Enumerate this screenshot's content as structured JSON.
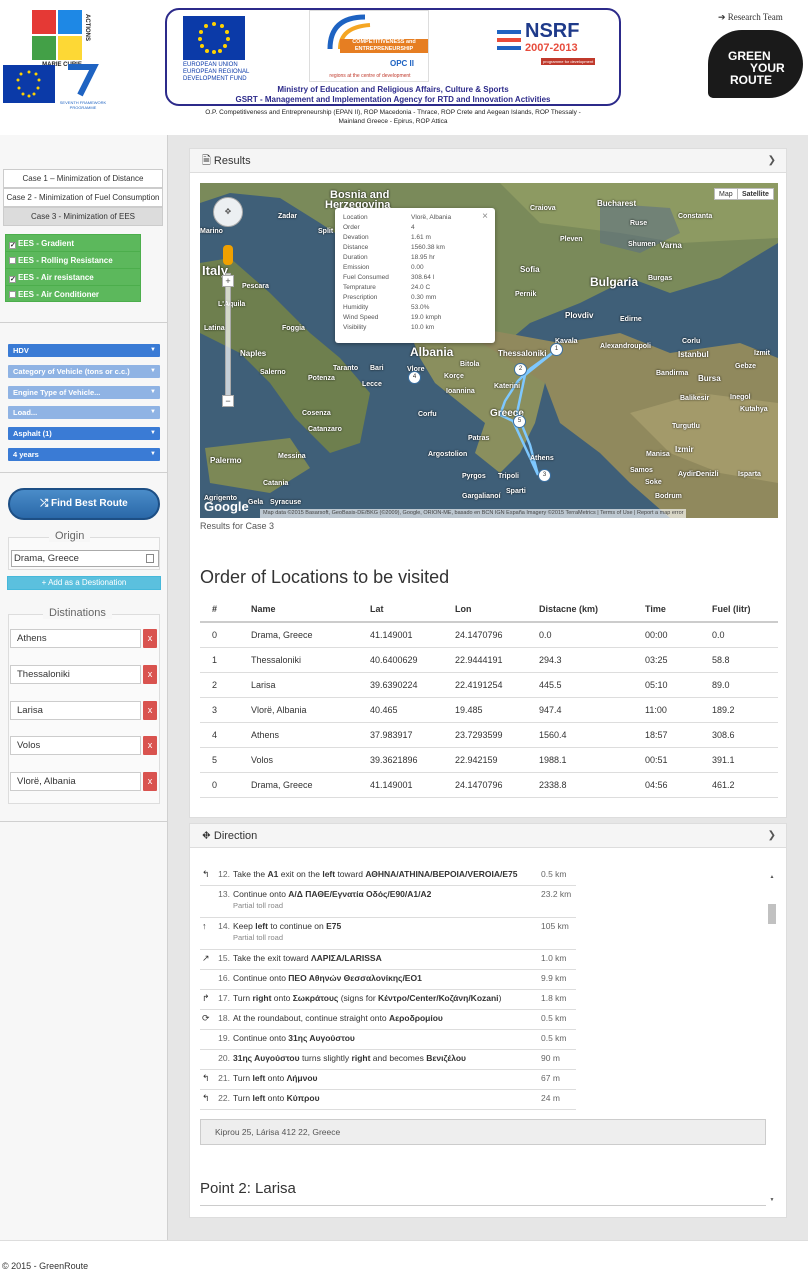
{
  "header": {
    "mc_label": "MARIE CURIE",
    "mc_actions": "ACTIONS",
    "fp7_label": "SEVENTH FRAMEWORK PROGRAMME",
    "eu_text": [
      "EUROPEAN UNION",
      "EUROPEAN REGIONAL",
      "DEVELOPMENT FUND"
    ],
    "opc_title": "COMPETITIVENESS and ENTREPRENEURSHIP",
    "opc_sub": "OPC II",
    "opc_tagline": "regions at the centre of development",
    "nsrf_title": "NSRF",
    "nsrf_years": "2007-2013",
    "nsrf_sub": "programme for development",
    "ministry_line1": "Ministry of Education and Religious Affairs, Culture & Sports",
    "ministry_line2": "GSRT -  Management and Implementation Agency for RTD and Innovation Activities",
    "sub_line1": "O.P. Competitiveness and Entrepreneurship (EPAN II), ROP Macedonia - Thrace, ROP Crete and Aegean Islands, ROP Thessaly -",
    "sub_line2": "Mainland Greece - Epirus, ROP Attica",
    "research_team": "Research Team",
    "logo_words": [
      "GREEN",
      "YOUR",
      "ROUTE"
    ]
  },
  "sidebar": {
    "cases": [
      {
        "label": "Case 1 – Minimization of Distance",
        "active": false
      },
      {
        "label": "Case 2 - Minimization of Fuel Consumption",
        "active": false
      },
      {
        "label": "Case 3 - Minimization of EES",
        "active": true
      }
    ],
    "ees": [
      {
        "label": "EES - Gradient",
        "checked": true
      },
      {
        "label": "EES - Rolling Resistance",
        "checked": false
      },
      {
        "label": "EES - Air resistance",
        "checked": true
      },
      {
        "label": "EES - Air Conditioner",
        "checked": false
      }
    ],
    "selects": [
      {
        "label": "HDV",
        "style": "dark"
      },
      {
        "label": "Category of Vehicle (tons or c.c.)",
        "style": "light"
      },
      {
        "label": "Engine Type of Vehicle...",
        "style": "light"
      },
      {
        "label": "Load...",
        "style": "light"
      },
      {
        "label": "Asphalt (1)",
        "style": "dark"
      },
      {
        "label": "4 years",
        "style": "dark"
      }
    ],
    "find_button": "Find Best Route",
    "origin_legend": "Origin",
    "origin_value": "Drama, Greece",
    "add_destination": "+ Add as a Destionation",
    "destinations_legend": "Distinations",
    "destinations": [
      "Athens",
      "Thessaloniki",
      "Larisa",
      "Volos",
      "Vlorë, Albania"
    ],
    "remove_label": "x"
  },
  "results": {
    "title": "Results",
    "results_for": "Results for Case 3",
    "map_buttons": [
      "Map",
      "Satellite"
    ],
    "map_credit": "Map data ©2015 Basarsoft, GeoBasis-DE/BKG (©2009), Google, ORION-ME, basado en BCN IGN España Imagery ©2015 TerraMetrics | Terms of Use | Report a map error",
    "google": "Google",
    "map_labels": [
      {
        "text": "Bosnia and",
        "size": 11
      },
      {
        "text": "Herzegovina",
        "size": 11
      },
      {
        "text": "Bulgaria",
        "size": 12
      },
      {
        "text": "Albania",
        "size": 12
      },
      {
        "text": "Greece",
        "size": 10
      },
      {
        "text": "Italy",
        "size": 13
      },
      {
        "text": "Bucharest",
        "size": 8
      },
      {
        "text": "Sofia",
        "size": 8
      },
      {
        "text": "Thessaloniki",
        "size": 8
      },
      {
        "text": "Naples",
        "size": 8
      },
      {
        "text": "Palermo",
        "size": 8
      },
      {
        "text": "Istanbul",
        "size": 8
      },
      {
        "text": "Izmir",
        "size": 8
      },
      {
        "text": "Bursa",
        "size": 8
      },
      {
        "text": "Plovdiv",
        "size": 8
      },
      {
        "text": "Varna",
        "size": 8
      },
      {
        "text": "Split",
        "size": 7
      },
      {
        "text": "Zadar",
        "size": 7
      },
      {
        "text": "Craiova",
        "size": 7
      },
      {
        "text": "Constanta",
        "size": 7
      },
      {
        "text": "Burgas",
        "size": 7
      },
      {
        "text": "Edirne",
        "size": 7
      },
      {
        "text": "Corfu",
        "size": 7
      },
      {
        "text": "Patras",
        "size": 7
      },
      {
        "text": "Athens",
        "size": 7
      },
      {
        "text": "Messina",
        "size": 7
      },
      {
        "text": "Catania",
        "size": 7
      },
      {
        "text": "Lecce",
        "size": 7
      },
      {
        "text": "Taranto",
        "size": 7
      },
      {
        "text": "Bari",
        "size": 7
      },
      {
        "text": "Pescara",
        "size": 7
      },
      {
        "text": "Foggia",
        "size": 7
      },
      {
        "text": "Salerno",
        "size": 7
      },
      {
        "text": "Cosenza",
        "size": 7
      },
      {
        "text": "Catanzaro",
        "size": 7
      },
      {
        "text": "Syracuse",
        "size": 7
      },
      {
        "text": "Gela",
        "size": 7
      },
      {
        "text": "Agrigento",
        "size": 7
      },
      {
        "text": "Ioannina",
        "size": 7
      },
      {
        "text": "Bitola",
        "size": 7
      },
      {
        "text": "Korçe",
        "size": 7
      },
      {
        "text": "Katerini",
        "size": 7
      },
      {
        "text": "Pleven",
        "size": 7
      },
      {
        "text": "Ruse",
        "size": 7
      },
      {
        "text": "Shumen",
        "size": 7
      },
      {
        "text": "Balikesir",
        "size": 7
      },
      {
        "text": "Inegol",
        "size": 7
      },
      {
        "text": "Kutahya",
        "size": 7
      },
      {
        "text": "Aydin",
        "size": 7
      },
      {
        "text": "Denizli",
        "size": 7
      },
      {
        "text": "Isparta",
        "size": 7
      },
      {
        "text": "Samos",
        "size": 7
      },
      {
        "text": "Bodrum",
        "size": 7
      },
      {
        "text": "Soke",
        "size": 7
      },
      {
        "text": "Tripoli",
        "size": 7
      },
      {
        "text": "Pyrgos",
        "size": 7
      },
      {
        "text": "Gargalianoí",
        "size": 7
      },
      {
        "text": "Sparti",
        "size": 7
      },
      {
        "text": "Argostolion",
        "size": 7
      },
      {
        "text": "Kavala",
        "size": 7
      },
      {
        "text": "Alexandroupoli",
        "size": 7
      },
      {
        "text": "Corlu",
        "size": 7
      },
      {
        "text": "Izmit",
        "size": 7
      },
      {
        "text": "Gebze",
        "size": 7
      },
      {
        "text": "Turgutlu",
        "size": 7
      },
      {
        "text": "Manisa",
        "size": 7
      },
      {
        "text": "Bandirma",
        "size": 7
      },
      {
        "text": "Pernik",
        "size": 7
      },
      {
        "text": "Latina",
        "size": 7
      },
      {
        "text": "L'Aquila",
        "size": 7
      },
      {
        "text": "Potenza",
        "size": 7
      },
      {
        "text": "Marino",
        "size": 7
      },
      {
        "text": "Vlore",
        "size": 7
      }
    ],
    "markers": [
      "1",
      "2",
      "3",
      "4",
      "5"
    ],
    "info": {
      "close": "×",
      "rows": [
        {
          "k": "Location",
          "v": "Vlorë, Albania"
        },
        {
          "k": "Order",
          "v": "4"
        },
        {
          "k": "Devation",
          "v": "1.61 m"
        },
        {
          "k": "Distance",
          "v": "1560.38 km"
        },
        {
          "k": "Duration",
          "v": "18.95 hr"
        },
        {
          "k": "Emission",
          "v": "0.00"
        },
        {
          "k": "Fuel Consumed",
          "v": "308.64 l"
        },
        {
          "k": "Temprature",
          "v": "24.0 C"
        },
        {
          "k": "Prescription",
          "v": "0.30 mm"
        },
        {
          "k": "Humidity",
          "v": "53.0%"
        },
        {
          "k": "Wind Speed",
          "v": "19.0 kmph"
        },
        {
          "k": "Visibility",
          "v": "10.0 km"
        }
      ]
    },
    "order_title": "Order of Locations to be visited",
    "table": {
      "headers": [
        "#",
        "Name",
        "Lat",
        "Lon",
        "Distacne (km)",
        "Time",
        "Fuel (litr)"
      ],
      "rows": [
        [
          "0",
          "Drama, Greece",
          "41.149001",
          "24.1470796",
          "0.0",
          "00:00",
          "0.0"
        ],
        [
          "1",
          "Thessaloniki",
          "40.6400629",
          "22.9444191",
          "294.3",
          "03:25",
          "58.8"
        ],
        [
          "2",
          "Larisa",
          "39.6390224",
          "22.4191254",
          "445.5",
          "05:10",
          "89.0"
        ],
        [
          "3",
          "Vlorë, Albania",
          "40.465",
          "19.485",
          "947.4",
          "11:00",
          "189.2"
        ],
        [
          "4",
          "Athens",
          "37.983917",
          "23.7293599",
          "1560.4",
          "18:57",
          "308.6"
        ],
        [
          "5",
          "Volos",
          "39.3621896",
          "22.942159",
          "1988.1",
          "00:51",
          "391.1"
        ],
        [
          "0",
          "Drama, Greece",
          "41.149001",
          "24.1470796",
          "2338.8",
          "04:56",
          "461.2"
        ]
      ]
    }
  },
  "direction": {
    "title": "Direction",
    "steps": [
      {
        "icon": "↰",
        "num": "12.",
        "html": "Take the <b>A1</b> exit on the <b>left</b> toward <b>ΑΘΗΝΑ/ATHINA/ΒΕΡΟΙΑ/VEROIA/E75</b>",
        "dist": "0.5 km",
        "sub": ""
      },
      {
        "icon": "",
        "num": "13.",
        "html": "Continue onto <b>Α/Δ ΠΑΘΕ/Εγνατία Οδός/E90/A1/A2</b>",
        "dist": "23.2 km",
        "sub": "Partial toll road"
      },
      {
        "icon": "↑",
        "num": "14.",
        "html": "Keep <b>left</b> to continue on <b>E75</b>",
        "dist": "105 km",
        "sub": "Partial toll road"
      },
      {
        "icon": "↗",
        "num": "15.",
        "html": "Take the exit toward <b>ΛΑΡΙΣΑ/LARISSA</b>",
        "dist": "1.0 km",
        "sub": ""
      },
      {
        "icon": "",
        "num": "16.",
        "html": "Continue onto <b>ΠΕΟ Αθηνών Θεσσαλονίκης/ΕΟ1</b>",
        "dist": "9.9 km",
        "sub": ""
      },
      {
        "icon": "↱",
        "num": "17.",
        "html": "Turn <b>right</b> onto <b>Σωκράτους</b> (signs for <b>Κέντρο/Center/Κοζάνη/Kozani</b>)",
        "dist": "1.8 km",
        "sub": ""
      },
      {
        "icon": "⟳",
        "num": "18.",
        "html": "At the roundabout, continue straight onto <b>Αεροδρομίου</b>",
        "dist": "0.5 km",
        "sub": ""
      },
      {
        "icon": "",
        "num": "19.",
        "html": "Continue onto <b>31ης Αυγούστου</b>",
        "dist": "0.5 km",
        "sub": ""
      },
      {
        "icon": "",
        "num": "20.",
        "html": "<b>31ης Αυγούστου</b> turns slightly <b>right</b> and becomes <b>Βενιζέλου</b>",
        "dist": "90 m",
        "sub": ""
      },
      {
        "icon": "↰",
        "num": "21.",
        "html": "Turn <b>left</b> onto <b>Λήμνου</b>",
        "dist": "67 m",
        "sub": ""
      },
      {
        "icon": "↰",
        "num": "22.",
        "html": "Turn <b>left</b> onto <b>Κύπρου</b>",
        "dist": "24 m",
        "sub": ""
      }
    ],
    "address": "Kiprou 25, Lárisa 412 22, Greece",
    "point_title": "Point 2: Larisa"
  },
  "footer": "© 2015 - GreenRoute",
  "colors": {
    "green": "#5cb85c",
    "blue": "#3a7bd5",
    "danger": "#d9534f",
    "info": "#5bc0de"
  }
}
